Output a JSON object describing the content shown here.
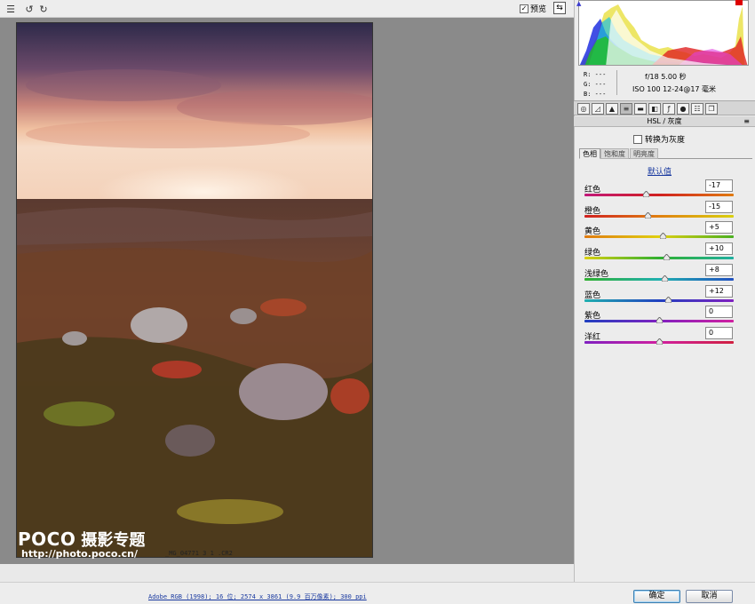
{
  "toolbar": {
    "preview_label": "预览",
    "preview_checked": "✓"
  },
  "canvas": {
    "watermark_brand": "POCO",
    "watermark_title": "摄影专题",
    "watermark_url": "http://photo.poco.cn/",
    "filename": "_MG_04771 3 1 .CR2"
  },
  "info": {
    "r": "R:  ---",
    "g": "G:  ---",
    "b": "B:  ---",
    "exif_line1": "f/18   5.00 秒",
    "exif_line2": "ISO 100   12-24@17 毫米"
  },
  "panel": {
    "section_title": "HSL / 灰度",
    "convert_gray_label": "转换为灰度",
    "subtabs": [
      "色相",
      "饱和度",
      "明亮度"
    ],
    "defaults_label": "默认值",
    "sliders": [
      {
        "label": "红色",
        "value": "-17",
        "num": -17,
        "gradient": "linear-gradient(90deg,#c2187a,#d02020,#e07a10)"
      },
      {
        "label": "橙色",
        "value": "-15",
        "num": -15,
        "gradient": "linear-gradient(90deg,#d02020,#e08010,#d9d010)"
      },
      {
        "label": "黄色",
        "value": "+5",
        "num": 5,
        "gradient": "linear-gradient(90deg,#e07a10,#e0d010,#4ab020)"
      },
      {
        "label": "绿色",
        "value": "+10",
        "num": 10,
        "gradient": "linear-gradient(90deg,#d9d010,#30b030,#20b0a0)"
      },
      {
        "label": "浅绿色",
        "value": "+8",
        "num": 8,
        "gradient": "linear-gradient(90deg,#30b030,#20b0b0,#2050c0)"
      },
      {
        "label": "蓝色",
        "value": "+12",
        "num": 12,
        "gradient": "linear-gradient(90deg,#20b0b0,#2040c0,#8020c0)"
      },
      {
        "label": "紫色",
        "value": "0",
        "num": 0,
        "gradient": "linear-gradient(90deg,#2040c0,#8020c0,#d020a0)"
      },
      {
        "label": "洋红",
        "value": "0",
        "num": 0,
        "gradient": "linear-gradient(90deg,#8020c0,#d020a0,#d02040)"
      }
    ]
  },
  "footer": {
    "workflow_link": "Adobe RGB (1998); 16 位; 2574 x 3861 (9.9 百万像素); 300 ppi",
    "ok_label": "确定",
    "cancel_label": "取消"
  },
  "colors": {
    "link": "#1a3aa0",
    "canvas_bg": "#8a8a8a",
    "panel_bg": "#ececec"
  }
}
